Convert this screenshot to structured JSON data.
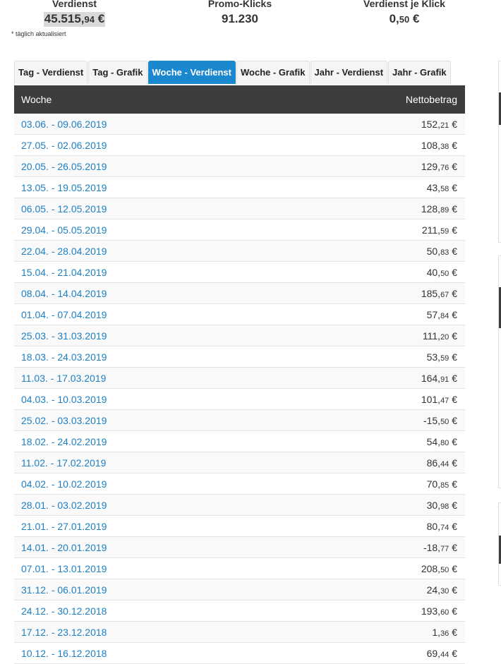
{
  "stats": {
    "earnings": {
      "label": "Verdienst",
      "whole": "45.515,",
      "cents": "94",
      "currency": "€"
    },
    "clicks": {
      "label": "Promo-Klicks",
      "value": "91.230"
    },
    "per_click": {
      "label": "Verdienst je Klick",
      "whole": "0,",
      "cents": "50",
      "currency": "€"
    },
    "note": "* täglich aktualisiert"
  },
  "tabs": [
    {
      "label": "Tag - Verdienst",
      "active": false
    },
    {
      "label": "Tag - Grafik",
      "active": false
    },
    {
      "label": "Woche - Verdienst",
      "active": true
    },
    {
      "label": "Woche - Grafik",
      "active": false
    },
    {
      "label": "Jahr - Verdienst",
      "active": false
    },
    {
      "label": "Jahr - Grafik",
      "active": false
    }
  ],
  "table": {
    "headers": {
      "week": "Woche",
      "amount": "Nettobetrag"
    },
    "currency": "€",
    "rows": [
      {
        "week": "03.06. - 09.06.2019",
        "whole": "152,",
        "cents": "21"
      },
      {
        "week": "27.05. - 02.06.2019",
        "whole": "108,",
        "cents": "38"
      },
      {
        "week": "20.05. - 26.05.2019",
        "whole": "129,",
        "cents": "76"
      },
      {
        "week": "13.05. - 19.05.2019",
        "whole": "43,",
        "cents": "58"
      },
      {
        "week": "06.05. - 12.05.2019",
        "whole": "128,",
        "cents": "89"
      },
      {
        "week": "29.04. - 05.05.2019",
        "whole": "211,",
        "cents": "59"
      },
      {
        "week": "22.04. - 28.04.2019",
        "whole": "50,",
        "cents": "83"
      },
      {
        "week": "15.04. - 21.04.2019",
        "whole": "40,",
        "cents": "50"
      },
      {
        "week": "08.04. - 14.04.2019",
        "whole": "185,",
        "cents": "67"
      },
      {
        "week": "01.04. - 07.04.2019",
        "whole": "57,",
        "cents": "84"
      },
      {
        "week": "25.03. - 31.03.2019",
        "whole": "111,",
        "cents": "20"
      },
      {
        "week": "18.03. - 24.03.2019",
        "whole": "53,",
        "cents": "59"
      },
      {
        "week": "11.03. - 17.03.2019",
        "whole": "164,",
        "cents": "91"
      },
      {
        "week": "04.03. - 10.03.2019",
        "whole": "101,",
        "cents": "47"
      },
      {
        "week": "25.02. - 03.03.2019",
        "whole": "-15,",
        "cents": "50"
      },
      {
        "week": "18.02. - 24.02.2019",
        "whole": "54,",
        "cents": "80"
      },
      {
        "week": "11.02. - 17.02.2019",
        "whole": "86,",
        "cents": "44"
      },
      {
        "week": "04.02. - 10.02.2019",
        "whole": "70,",
        "cents": "85"
      },
      {
        "week": "28.01. - 03.02.2019",
        "whole": "30,",
        "cents": "98"
      },
      {
        "week": "21.01. - 27.01.2019",
        "whole": "80,",
        "cents": "74"
      },
      {
        "week": "14.01. - 20.01.2019",
        "whole": "-18,",
        "cents": "77"
      },
      {
        "week": "07.01. - 13.01.2019",
        "whole": "208,",
        "cents": "50"
      },
      {
        "week": "31.12. - 06.01.2019",
        "whole": "24,",
        "cents": "30"
      },
      {
        "week": "24.12. - 30.12.2018",
        "whole": "193,",
        "cents": "60"
      },
      {
        "week": "17.12. - 23.12.2018",
        "whole": "1,",
        "cents": "36"
      },
      {
        "week": "10.12. - 16.12.2018",
        "whole": "69,",
        "cents": "44"
      }
    ]
  },
  "colors": {
    "active_tab": "#1a87cf",
    "link": "#1d7fc4",
    "table_header": "#3d3d3d"
  }
}
